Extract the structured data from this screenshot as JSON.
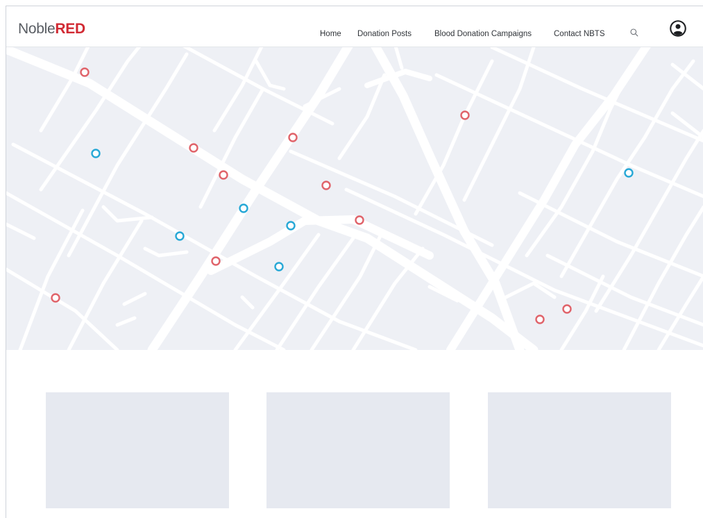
{
  "brand": {
    "prefix": "Noble",
    "accent": "RED",
    "accent_color": "#d12a33",
    "text_color": "#595d63"
  },
  "nav": {
    "items": [
      {
        "label": "Home"
      },
      {
        "label": "Donation Posts"
      },
      {
        "label": "Blood Donation Campaigns"
      },
      {
        "label": "Contact NBTS"
      }
    ],
    "search_icon": "search-icon",
    "account_icon": "user-circle-icon"
  },
  "map": {
    "marker_colors": {
      "red": "#e0636a",
      "blue": "#27a8d6"
    },
    "marker_types": [
      "red",
      "blue",
      "red",
      "red",
      "red",
      "red",
      "blue",
      "blue",
      "red",
      "red",
      "blue",
      "red",
      "blue",
      "red",
      "red",
      "red",
      "red",
      "blue"
    ]
  },
  "cards": [
    {
      "id": "card-1"
    },
    {
      "id": "card-2"
    },
    {
      "id": "card-3"
    }
  ]
}
